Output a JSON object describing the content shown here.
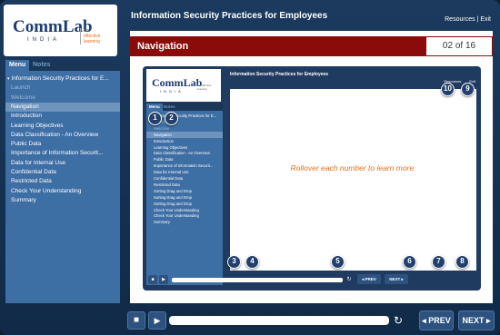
{
  "logo": {
    "main": "CommLab",
    "sub": "INDIA",
    "tag_pre": "for",
    "tag_accent": "effective learning"
  },
  "header": {
    "title": "Information Security Practices for Employees",
    "resources": "Resources",
    "separator": "|",
    "exit": "Exit"
  },
  "tabs": {
    "menu": "Menu",
    "notes": "Notes"
  },
  "menu": {
    "items": [
      {
        "label": "Information Security Practices for E...",
        "state": "top"
      },
      {
        "label": "Launch",
        "state": "visited"
      },
      {
        "label": "Welcome",
        "state": "visited"
      },
      {
        "label": "Navigation",
        "state": "active"
      },
      {
        "label": "Introduction",
        "state": "normal"
      },
      {
        "label": "Learning Objectives",
        "state": "normal"
      },
      {
        "label": "Data Classification - An Overview",
        "state": "normal"
      },
      {
        "label": "Public Data",
        "state": "normal"
      },
      {
        "label": "Importance of Information Securit...",
        "state": "normal"
      },
      {
        "label": "Data for Internal Use",
        "state": "normal"
      },
      {
        "label": "Confidential Data",
        "state": "normal"
      },
      {
        "label": "Restricted Data",
        "state": "normal"
      },
      {
        "label": "Check Your Understanding",
        "state": "normal"
      },
      {
        "label": "Summary",
        "state": "normal"
      }
    ]
  },
  "page": {
    "title": "Navigation",
    "counter": "02 of 16"
  },
  "inner": {
    "logo_main": "CommLab",
    "logo_sub": "INDIA",
    "logo_tag": "for effective learning",
    "title": "Information Security Practices for Employees",
    "resources": "Resources",
    "exit": "Exit",
    "tab_menu": "Menu",
    "tab_notes": "Notes",
    "instruction": "Rollover each number to learn more.",
    "prev": "◂ PREV",
    "next": "NEXT ▸",
    "menu_items": [
      {
        "label": "Information Security Practices for E...",
        "state": "normal"
      },
      {
        "label": "Launch",
        "state": "visited"
      },
      {
        "label": "Welcome",
        "state": "visited"
      },
      {
        "label": "Navigation",
        "state": "active"
      },
      {
        "label": "Introduction",
        "state": "normal"
      },
      {
        "label": "Learning Objectives",
        "state": "normal"
      },
      {
        "label": "Data Classification - An Overview",
        "state": "normal"
      },
      {
        "label": "Public Data",
        "state": "normal"
      },
      {
        "label": "Importance of Information Securit...",
        "state": "normal"
      },
      {
        "label": "Data for Internal Use",
        "state": "normal"
      },
      {
        "label": "Confidential Data",
        "state": "normal"
      },
      {
        "label": "Restricted Data",
        "state": "normal"
      },
      {
        "label": "Sorting Drag and Drop",
        "state": "normal"
      },
      {
        "label": "Sorting Drag and Drop",
        "state": "normal"
      },
      {
        "label": "Sorting Drag and Drop",
        "state": "normal"
      },
      {
        "label": "Check Your Understanding",
        "state": "normal"
      },
      {
        "label": "Check Your Understanding",
        "state": "normal"
      },
      {
        "label": "Summary",
        "state": "normal"
      }
    ],
    "callouts": [
      "1",
      "2",
      "3",
      "4",
      "5",
      "6",
      "7",
      "8",
      "9",
      "10"
    ]
  },
  "controls": {
    "volume_icon": "speaker-icon",
    "play_icon": "play-icon",
    "replay_icon": "replay-icon",
    "prev": "◂ PREV",
    "next": "NEXT ▸"
  },
  "colors": {
    "nav_bar": "#8b0a0a",
    "accent": "#e8701a",
    "menu_bg": "#3d6ea4",
    "frame": "#1b3a5e"
  }
}
